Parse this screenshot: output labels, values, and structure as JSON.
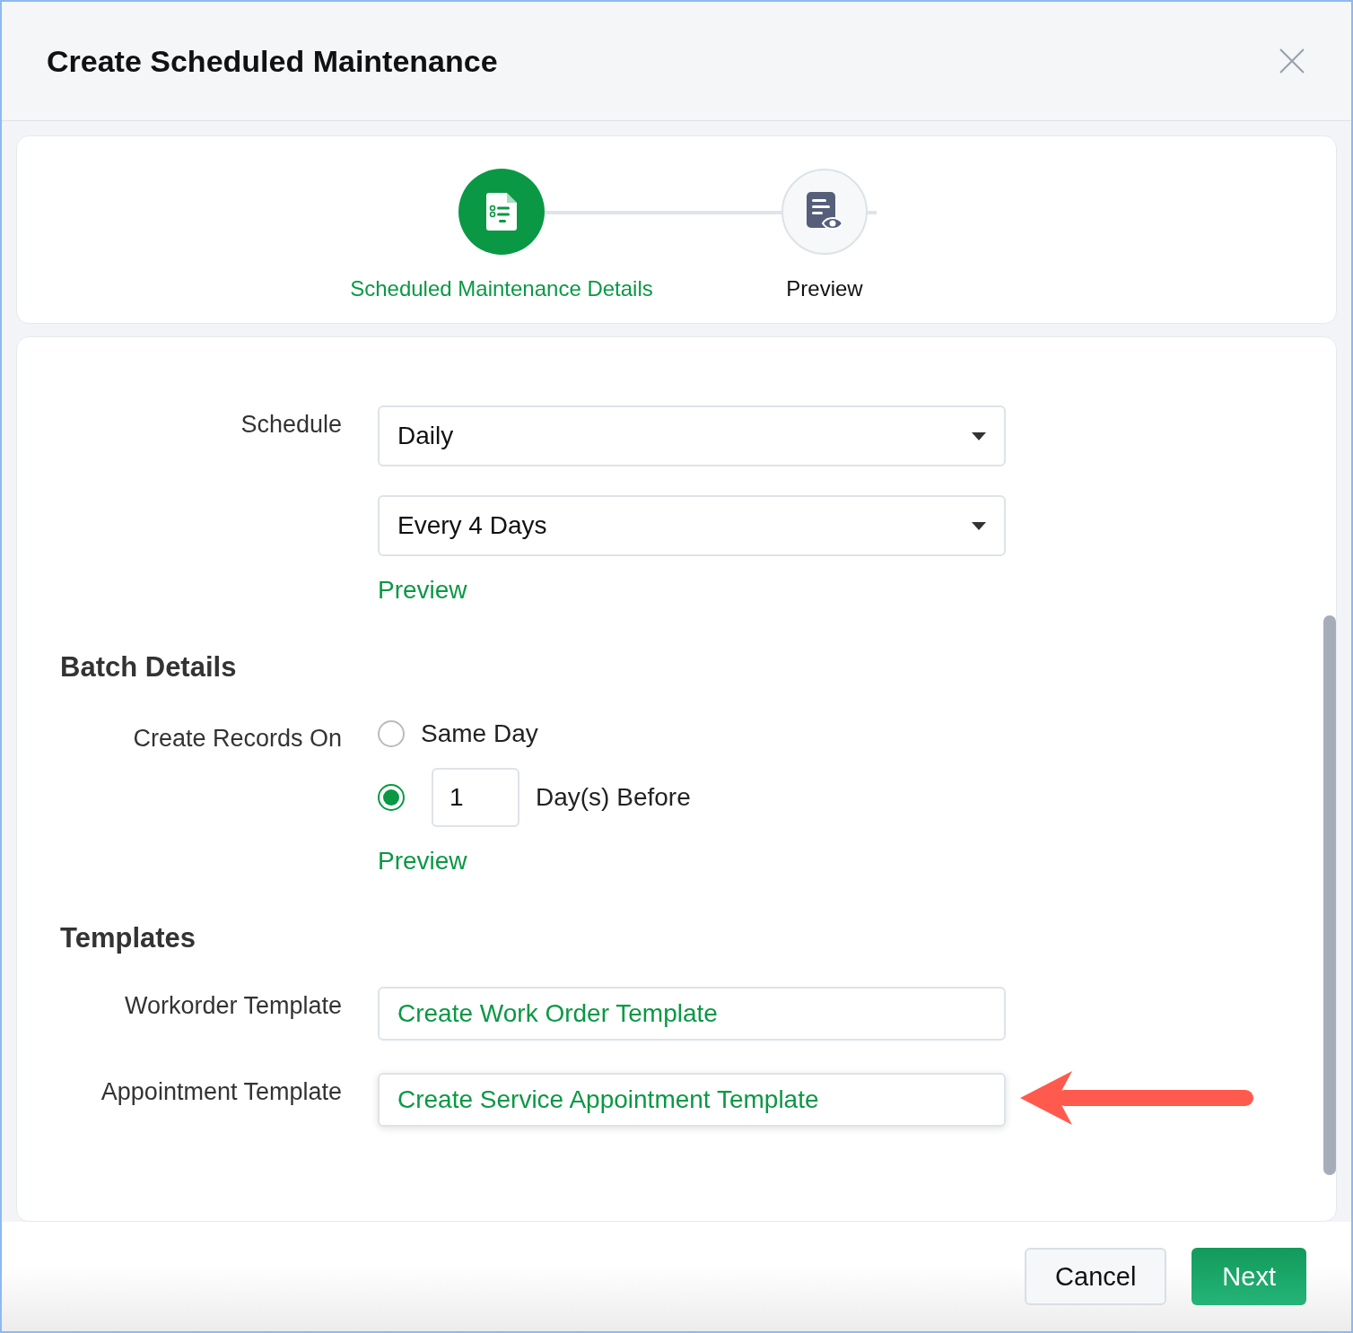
{
  "dialog": {
    "title": "Create Scheduled Maintenance"
  },
  "steps": [
    {
      "label": "Scheduled Maintenance Details",
      "selected": true
    },
    {
      "label": "Preview",
      "selected": false
    }
  ],
  "schedule": {
    "label": "Schedule",
    "frequency": "Daily",
    "interval": "Every 4 Days",
    "preview_link": "Preview"
  },
  "batch_details": {
    "heading": "Batch Details",
    "label": "Create Records On",
    "options": [
      {
        "kind": "radio",
        "label": "Same Day",
        "selected": false
      },
      {
        "kind": "radio_input",
        "value": "1",
        "label": "Day(s) Before",
        "selected": true
      }
    ],
    "preview_link": "Preview"
  },
  "templates": {
    "heading": "Templates",
    "rows": [
      {
        "label": "Workorder Template",
        "link": "Create Work Order Template",
        "highlighted": false
      },
      {
        "label": "Appointment Template",
        "link": "Create Service Appointment Template",
        "highlighted": true
      }
    ]
  },
  "footer": {
    "buttons": [
      {
        "kind": "secondary",
        "label": "Cancel"
      },
      {
        "kind": "primary",
        "label": "Next"
      }
    ]
  }
}
